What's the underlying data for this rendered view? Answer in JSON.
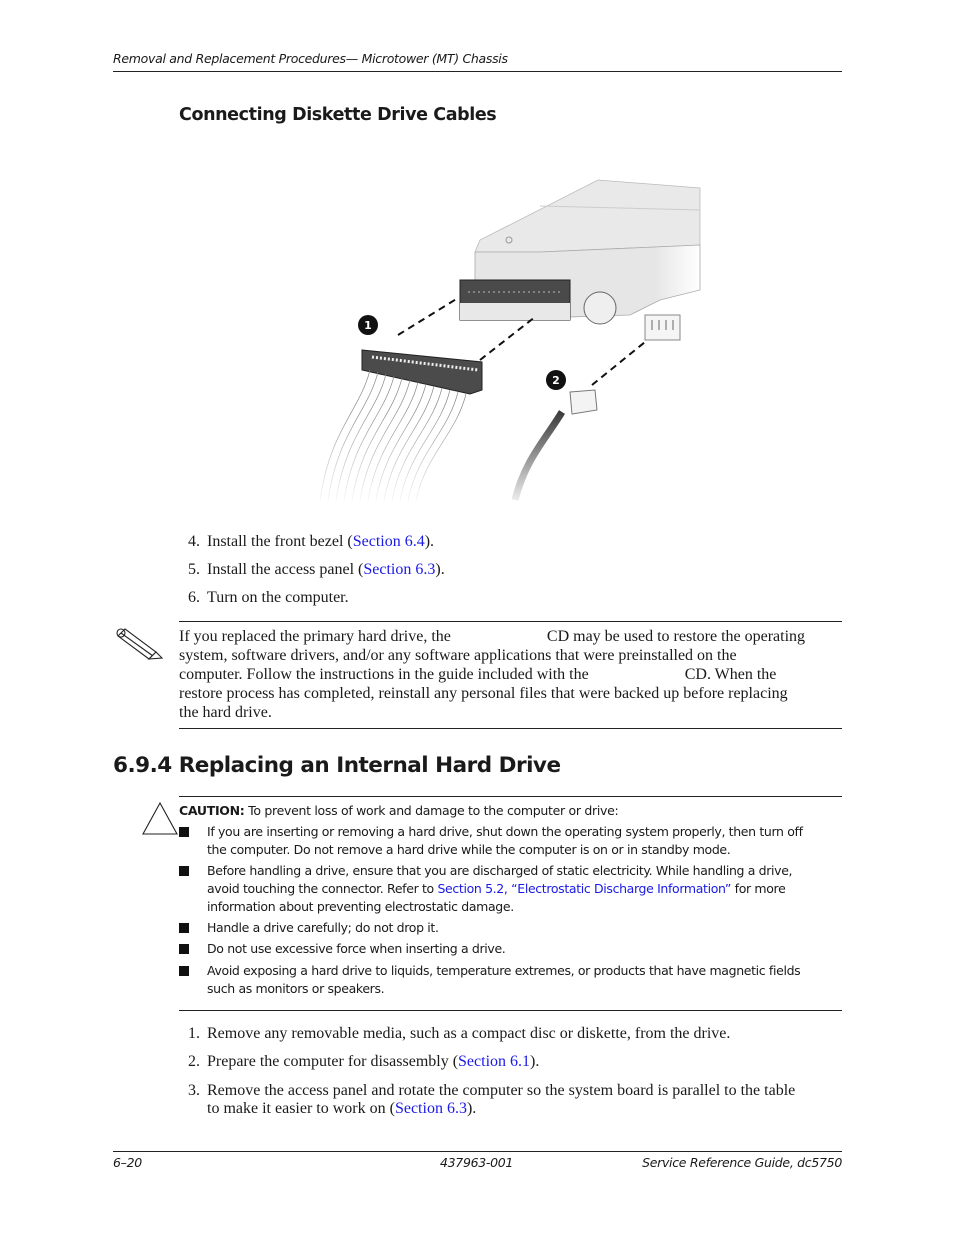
{
  "header": {
    "running_title": "Removal and Replacement Procedures— Microtower (MT) Chassis"
  },
  "figure": {
    "title": "Connecting Diskette Drive Cables",
    "callouts": [
      "1",
      "2"
    ],
    "description": "Diskette drive with data ribbon cable (1) and power cable (2) connecting to rear connectors"
  },
  "steps_top": [
    {
      "num": "4.",
      "pre": "Install the front bezel (",
      "link": "Section 6.4",
      "post": ")."
    },
    {
      "num": "5.",
      "pre": "Install the access panel (",
      "link": "Section 6.3",
      "post": ")."
    },
    {
      "num": "6.",
      "pre": "Turn on the computer.",
      "link": "",
      "post": ""
    }
  ],
  "note": {
    "icon": "pencil-note-icon",
    "line1_a": "If you replaced the primary hard drive, the",
    "line1_b": "CD may be used to restore the operating",
    "line2": "system, software drivers, and/or any software applications that were preinstalled on the",
    "line3_a": "computer. Follow the instructions in the guide included with the",
    "line3_b": "CD. When the",
    "line4": "restore process has completed, reinstall any personal files that were backed up before replacing",
    "line5": "the hard drive."
  },
  "section": {
    "title": "6.9.4 Replacing an Internal Hard Drive"
  },
  "caution": {
    "icon": "caution-triangle-icon",
    "label": "CAUTION:",
    "text": " To prevent loss of work and damage to the computer or drive:",
    "bullets": [
      {
        "lines": [
          "If you are inserting or removing a hard drive, shut down the operating system properly, then turn off",
          "the computer. Do not remove a hard drive while the computer is on or in standby mode."
        ]
      },
      {
        "pre": "Before handling a drive, ensure that you are discharged of static electricity. While handling a drive,",
        "pre2": "avoid touching the connector. Refer to ",
        "link": "Section 5.2, “Electrostatic Discharge Information”",
        "post": " for more",
        "line3": "information about preventing electrostatic damage."
      },
      {
        "lines": [
          "Handle a drive carefully; do not drop it."
        ]
      },
      {
        "lines": [
          "Do not use excessive force when inserting a drive."
        ]
      },
      {
        "lines": [
          "Avoid exposing a hard drive to liquids, temperature extremes, or products that have magnetic fields",
          "such as monitors or speakers."
        ]
      }
    ]
  },
  "steps_bottom": [
    {
      "num": "1.",
      "pre": "Remove any removable media, such as a compact disc or diskette, from the drive.",
      "link": "",
      "post": ""
    },
    {
      "num": "2.",
      "pre": "Prepare the computer for disassembly (",
      "link": "Section 6.1",
      "post": ")."
    },
    {
      "num": "3.",
      "pre": "Remove the access panel and rotate the computer so the system board is parallel to the table",
      "pre2": "to make it easier to work on (",
      "link": "Section 6.3",
      "post": ")."
    }
  ],
  "footer": {
    "page": "6–20",
    "part_number": "437963-001",
    "guide": "Service Reference Guide, dc5750"
  },
  "colors": {
    "link": "#1a1ae6",
    "text": "#1a1a1a"
  }
}
